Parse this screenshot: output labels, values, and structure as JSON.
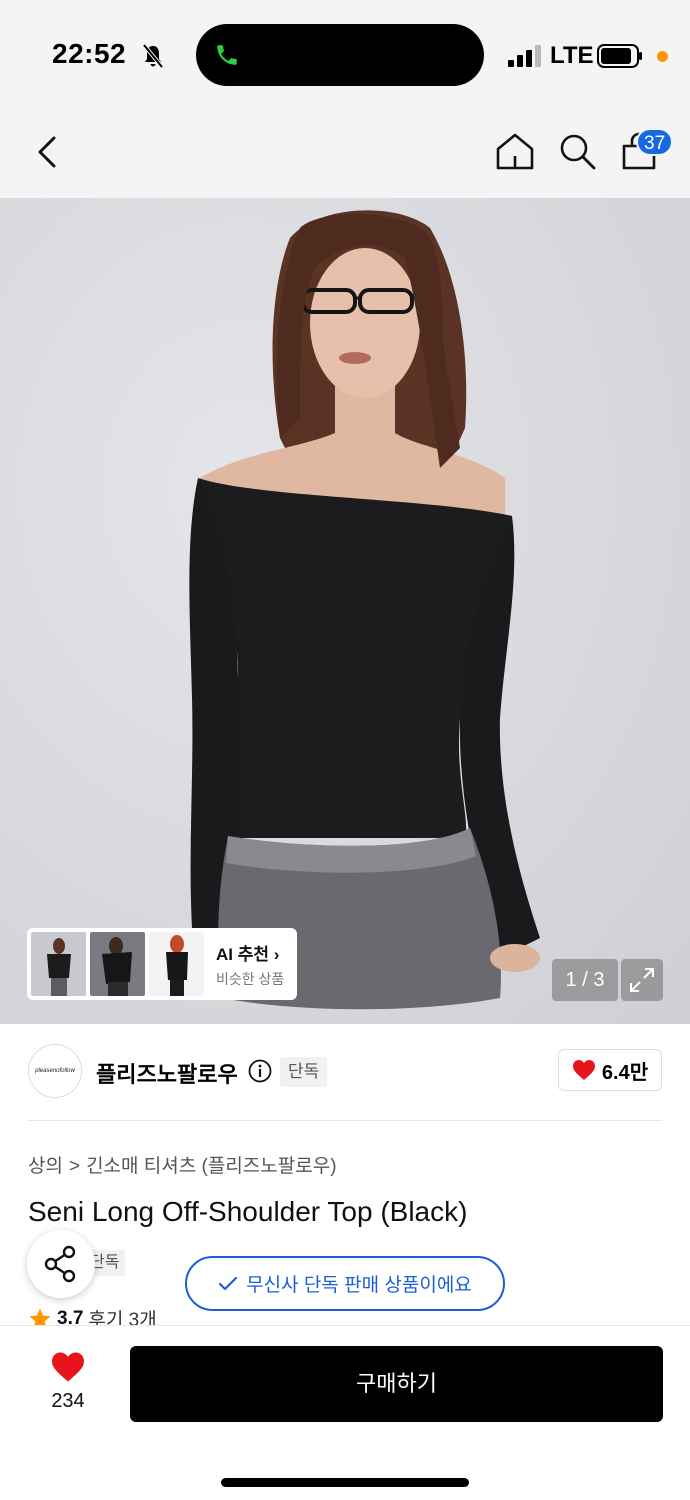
{
  "status_bar": {
    "time": "22:52",
    "network": "LTE"
  },
  "nav": {
    "cart_count": "37"
  },
  "hero": {
    "page_indicator": "1 / 3"
  },
  "ai_recommend": {
    "title": "AI 추천 ›",
    "subtitle": "비슷한 상품"
  },
  "brand": {
    "logo_text": "pleasenofollow",
    "name": "플리즈노팔로우",
    "exclusive_tag": "단독",
    "likes": "6.4만"
  },
  "breadcrumb": {
    "category": "상의",
    "separator": ">",
    "subcategory": "긴소매 티셔츠 (플리즈노팔로우)"
  },
  "product": {
    "title": "Seni Long Off-Shoulder Top (Black)",
    "tag": "단독"
  },
  "toast": {
    "text": "무신사 단독 판매 상품이에요"
  },
  "rating": {
    "score": "3.7",
    "reviews": "후기 3개"
  },
  "bottom": {
    "like_count": "234",
    "buy_label": "구매하기"
  },
  "colors": {
    "accent_blue": "#1a5fd6",
    "badge_blue": "#1668e3",
    "heart_red": "#e8141c",
    "star_orange": "#ff9500"
  }
}
